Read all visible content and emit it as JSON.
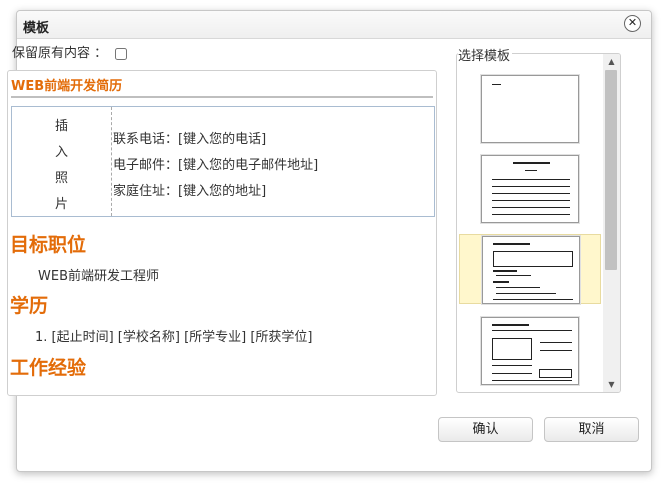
{
  "dialog": {
    "title": "模板",
    "close_glyph": "✕"
  },
  "keep": {
    "label": "保留原有内容 ：",
    "checked": false
  },
  "resume": {
    "title": "WEB前端开发简历",
    "photo_chars": [
      "插",
      "入",
      "照",
      "片"
    ],
    "contact": [
      "联系电话：[键入您的电话]",
      "电子邮件：[键入您的电子邮件地址]",
      "家庭住址：[键入您的地址]"
    ],
    "sections": [
      {
        "heading": "目标职位",
        "line": "WEB前端研发工程师"
      },
      {
        "heading": "学历",
        "line": "1. [起止时间] [学校名称] [所学专业] [所获学位]"
      },
      {
        "heading": "工作经验",
        "line": ""
      }
    ]
  },
  "picker": {
    "label": "选择模板",
    "selected_index": 2,
    "scroll_up": "▲",
    "scroll_down": "▼"
  },
  "buttons": {
    "confirm": "确认",
    "cancel": "取消"
  }
}
